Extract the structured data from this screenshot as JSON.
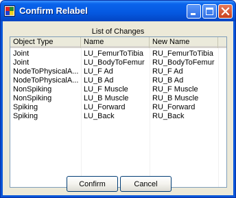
{
  "window": {
    "title": "Confirm Relabel"
  },
  "group": {
    "title": "List of Changes"
  },
  "columns": [
    "Object Type",
    "Name",
    "New Name"
  ],
  "rows": [
    [
      "Joint",
      "LU_FemurToTibia",
      "RU_FemurToTibia"
    ],
    [
      "Joint",
      "LU_BodyToFemur",
      "RU_BodyToFemur"
    ],
    [
      "NodeToPhysicalA...",
      "LU_F Ad",
      "RU_F Ad"
    ],
    [
      "NodeToPhysicalA...",
      "LU_B Ad",
      "RU_B Ad"
    ],
    [
      "NonSpiking",
      "LU_F Muscle",
      "RU_F Muscle"
    ],
    [
      "NonSpiking",
      "LU_B Muscle",
      "RU_B Muscle"
    ],
    [
      "Spiking",
      "LU_Forward",
      "RU_Forward"
    ],
    [
      "Spiking",
      "LU_Back",
      "RU_Back"
    ]
  ],
  "buttons": {
    "confirm": "Confirm",
    "cancel": "Cancel"
  },
  "icons": {
    "app": "app-icon",
    "minimize": "minimize-icon",
    "maximize": "maximize-icon",
    "close": "close-icon"
  },
  "colors": {
    "titlebar": "#0558e0",
    "close_button": "#c8401c",
    "dialog_background": "#ece9d8"
  }
}
